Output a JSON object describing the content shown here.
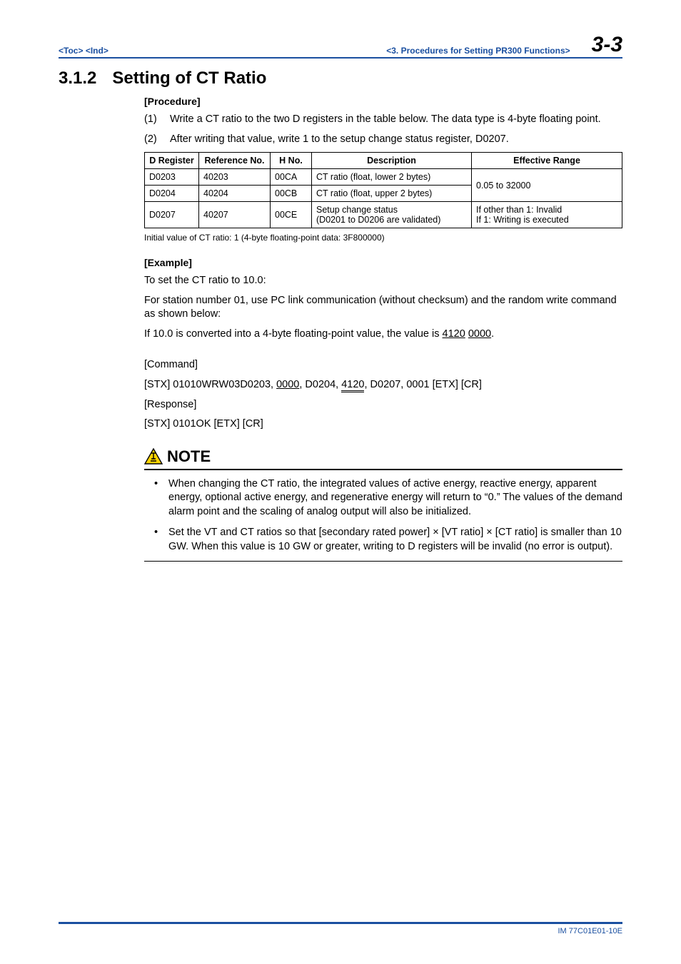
{
  "header": {
    "toc": "<Toc>",
    "ind": "<Ind>",
    "center": "<3.  Procedures for Setting PR300 Functions>",
    "page": "3-3"
  },
  "section": {
    "number": "3.1.2",
    "title": "Setting of CT Ratio"
  },
  "procedure": {
    "label": "[Procedure]",
    "items": [
      {
        "n": "(1)",
        "text": "Write a CT ratio to the two D registers in the table below. The data type is 4-byte floating point."
      },
      {
        "n": "(2)",
        "text": "After writing that value, write 1 to the setup change status register, D0207."
      }
    ]
  },
  "table": {
    "headers": {
      "c1": "D Register",
      "c2": "Reference No.",
      "c3": "H No.",
      "c4": "Description",
      "c5": "Effective Range"
    },
    "rows": [
      {
        "c1": "D0203",
        "c2": "40203",
        "c3": "00CA",
        "c4": "CT ratio (float, lower 2 bytes)"
      },
      {
        "c1": "D0204",
        "c2": "40204",
        "c3": "00CB",
        "c4": "CT ratio (float, upper 2 bytes)"
      },
      {
        "c1": "D0207",
        "c2": "40207",
        "c3": "00CE",
        "c4": "Setup change status\n(D0201 to D0206 are validated)",
        "c5": "If other than 1: Invalid\nIf 1: Writing is executed"
      }
    ],
    "range_shared": "0.05 to 32000",
    "note": "Initial value of CT ratio: 1 (4-byte floating-point data: 3F800000)"
  },
  "example": {
    "label": "[Example]",
    "p1": "To set the CT ratio to 10.0:",
    "p2": "For station number 01, use PC link communication (without checksum) and the random write command as shown below:",
    "p3_a": "If 10.0 is converted into a 4-byte floating-point value, the value is ",
    "p3_u1": "4120",
    "p3_sp": " ",
    "p3_u2": "0000",
    "p3_b": ".",
    "cmd_label": "[Command]",
    "cmd_a": "[STX] 01010WRW03D0203, ",
    "cmd_u1": "0000",
    "cmd_b": ", D0204, ",
    "cmd_u2": "4120",
    "cmd_c": ", D0207, 0001 [ETX] [CR]",
    "resp_label": "[Response]",
    "resp": "[STX] 0101OK [ETX] [CR]"
  },
  "note": {
    "title": "NOTE",
    "items": [
      "When changing the CT ratio, the integrated values of active energy, reactive energy, apparent energy, optional active energy, and regenerative energy will return to “0.” The values of the demand alarm point and the scaling of analog output will also be initialized.",
      "Set the VT and CT ratios so that [secondary rated power] × [VT ratio] × [CT ratio] is smaller than 10 GW. When this value is 10 GW or greater, writing to D registers will be invalid (no error is output)."
    ]
  },
  "footer": {
    "text": "IM 77C01E01-10E"
  }
}
